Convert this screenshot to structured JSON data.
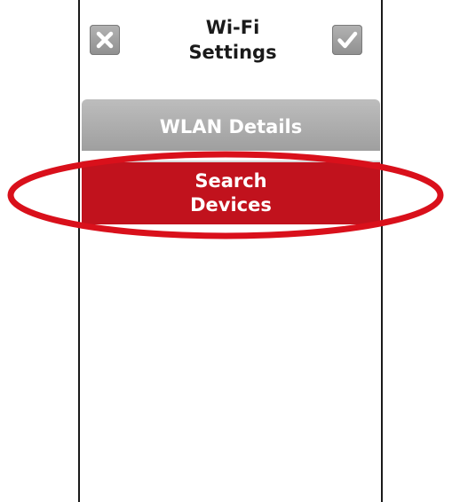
{
  "header": {
    "title_line1": "Wi-Fi",
    "title_line2": "Settings",
    "cancel_icon": "close-icon",
    "confirm_icon": "checkmark-icon"
  },
  "menu": {
    "items": [
      {
        "label": "WLAN Details",
        "state": "normal"
      },
      {
        "label_line1": "Search",
        "label_line2": "Devices",
        "state": "selected"
      }
    ]
  },
  "colors": {
    "selected_item": "#c1121d",
    "normal_item": "#a8a8a8",
    "highlight_ring": "#d9101b",
    "icon_button": "#9e9e9e"
  }
}
